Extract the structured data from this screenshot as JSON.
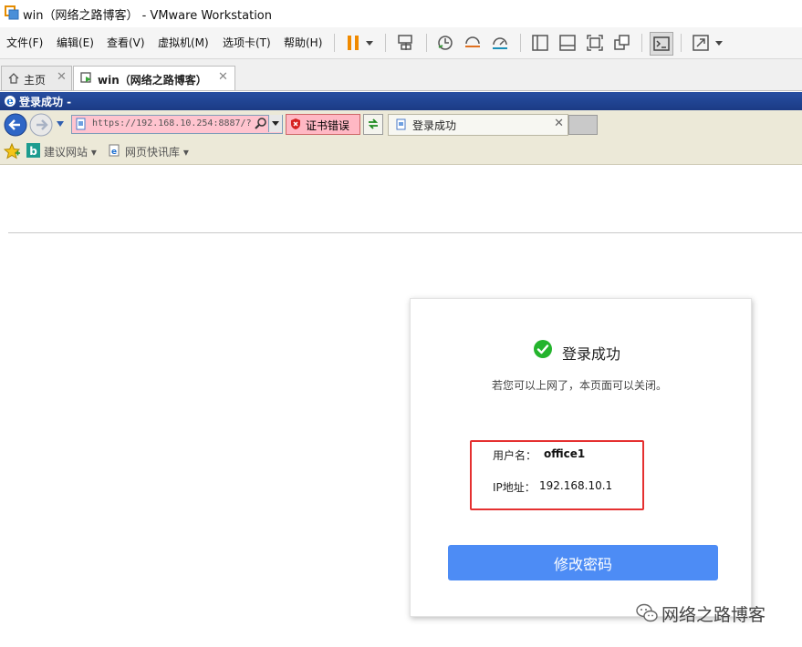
{
  "window": {
    "title": "win（网络之路博客） - VMware Workstation"
  },
  "menu": [
    "文件(F)",
    "编辑(E)",
    "查看(V)",
    "虚拟机(M)",
    "选项卡(T)",
    "帮助(H)"
  ],
  "toolbar_icons": [
    "pause-icon",
    "dropdown-icon",
    "send-ctrl-alt-del-icon",
    "snapshot-icon",
    "revert-snapshot-icon",
    "snapshot-manager-icon",
    "sidebar-view-icon",
    "console-view-icon",
    "fullscreen-icon",
    "unity-icon",
    "terminal-icon",
    "stretch-icon"
  ],
  "vm_tabs": [
    {
      "label": "主页",
      "icon": "home-icon"
    },
    {
      "label": "win（网络之路博客）",
      "icon": "vm-icon"
    }
  ],
  "ie": {
    "title": "登录成功 -",
    "address": "https://192.168.10.254:8887/?",
    "cert_error": "证书错误",
    "tab_title": "登录成功",
    "favorites": [
      {
        "label": "建议网站 ▾"
      },
      {
        "label": "网页快讯库 ▾"
      }
    ]
  },
  "page": {
    "heading": "登录成功",
    "note": "若您可以上网了，本页面可以关闭。",
    "username_label": "用户名：",
    "username": "office1",
    "ip_label": "IP地址：",
    "ip": "192.168.10.1",
    "change_password": "修改密码"
  },
  "watermark": "网络之路博客",
  "colors": {
    "accent_button": "#4d8cf5",
    "success": "#24b42d",
    "highlight_box": "#e53030",
    "ie_cert_error": "#ffb8c4"
  }
}
